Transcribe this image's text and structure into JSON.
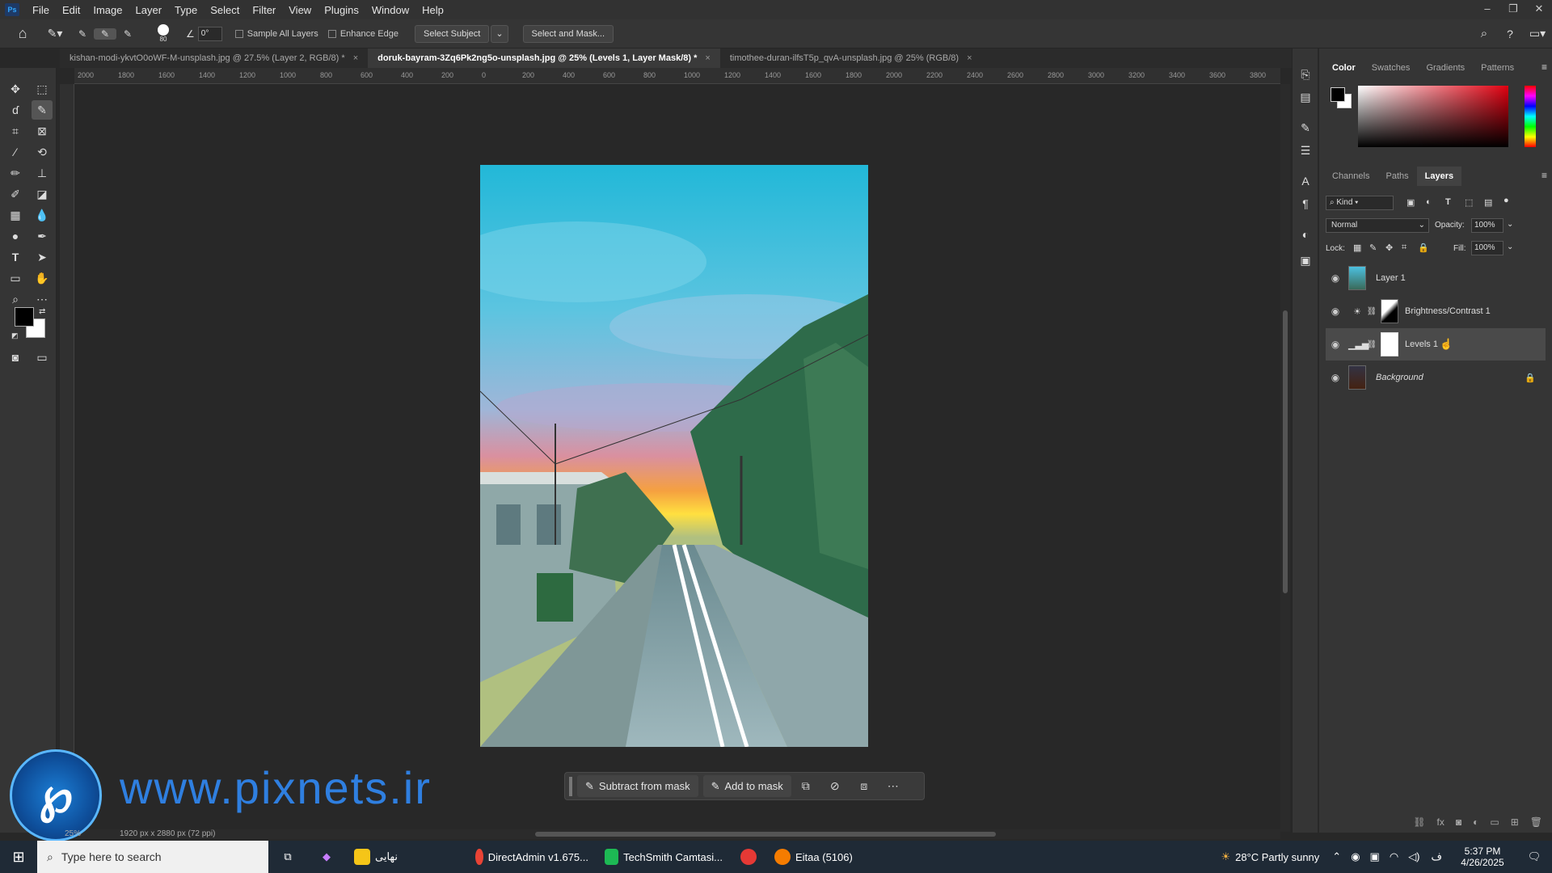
{
  "app": {
    "logo_text": "Ps"
  },
  "menu": [
    "File",
    "Edit",
    "Image",
    "Layer",
    "Type",
    "Select",
    "Filter",
    "View",
    "Plugins",
    "Window",
    "Help"
  ],
  "options": {
    "brush_size": "80",
    "angle": "0°",
    "sample_all_layers": "Sample All Layers",
    "enhance_edge": "Enhance Edge",
    "select_subject": "Select Subject",
    "select_and_mask": "Select and Mask..."
  },
  "tabs": [
    {
      "label": "kishan-modi-ykvtO0oWF-M-unsplash.jpg @ 27.5% (Layer 2, RGB/8) *",
      "active": false
    },
    {
      "label": "doruk-bayram-3Zq6Pk2ng5o-unsplash.jpg @ 25% (Levels 1, Layer Mask/8) *",
      "active": true
    },
    {
      "label": "timothee-duran-ilfsT5p_qvA-unsplash.jpg @ 25% (RGB/8)",
      "active": false
    }
  ],
  "ruler": {
    "top": [
      "2000",
      "1800",
      "1600",
      "1400",
      "1200",
      "1000",
      "800",
      "600",
      "400",
      "200",
      "0",
      "200",
      "400",
      "600",
      "800",
      "1000",
      "1200",
      "1400",
      "1600",
      "1800",
      "2000",
      "2200",
      "2400",
      "2600",
      "2800",
      "3000",
      "3200",
      "3400",
      "3600",
      "3800"
    ]
  },
  "context_bar": {
    "subtract": "Subtract from mask",
    "add": "Add to mask"
  },
  "status": {
    "zoom": "25%",
    "doc_size": "1920 px x 2880 px (72 ppi)"
  },
  "watermark": {
    "url": "www.pixnets.ir"
  },
  "color_panel": {
    "tabs": [
      "Color",
      "Swatches",
      "Gradients",
      "Patterns"
    ],
    "active": "Color"
  },
  "layers_panel": {
    "tabs": [
      "Channels",
      "Paths",
      "Layers"
    ],
    "active": "Layers",
    "filter_kind": "Kind",
    "blend_mode": "Normal",
    "opacity_label": "Opacity:",
    "opacity": "100%",
    "lock_label": "Lock:",
    "fill_label": "Fill:",
    "fill": "100%",
    "layers": [
      {
        "name": "Layer 1",
        "selected": false,
        "italic": false
      },
      {
        "name": "Brightness/Contrast 1",
        "selected": false,
        "italic": false
      },
      {
        "name": "Levels 1",
        "selected": true,
        "italic": false
      },
      {
        "name": "Background",
        "selected": false,
        "italic": true
      }
    ]
  },
  "taskbar": {
    "search_placeholder": "Type here to search",
    "apps": [
      {
        "label": "نهایی",
        "color": "#f5c518"
      },
      {
        "label": "DirectAdmin v1.675...",
        "color": "#e94335"
      },
      {
        "label": "TechSmith Camtasi...",
        "color": "#1db954"
      },
      {
        "label": "Eitaa (5106)",
        "color": "#f57c00"
      }
    ],
    "weather": "28°C  Partly sunny",
    "lang": "ف",
    "time": "5:37 PM",
    "date": "4/26/2025"
  },
  "colors": {
    "accent": "#31a8ff",
    "fg_swatch": "#000000",
    "bg_swatch": "#ffffff"
  }
}
